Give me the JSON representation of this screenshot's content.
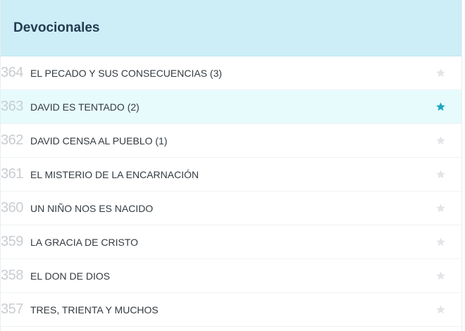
{
  "header": {
    "title": "Devocionales"
  },
  "colors": {
    "header_bg": "#cdeef6",
    "highlight_bg": "#e7fbfd",
    "star_active": "#1aa7c4",
    "star_inactive": "#e2e5e8"
  },
  "items": [
    {
      "number": "364",
      "title": "EL PECADO Y SUS CONSECUENCIAS (3)",
      "favorite": false,
      "highlighted": false
    },
    {
      "number": "363",
      "title": "DAVID ES TENTADO (2)",
      "favorite": true,
      "highlighted": true
    },
    {
      "number": "362",
      "title": "DAVID CENSA AL PUEBLO (1)",
      "favorite": false,
      "highlighted": false
    },
    {
      "number": "361",
      "title": "EL MISTERIO DE LA ENCARNACIÓN",
      "favorite": false,
      "highlighted": false
    },
    {
      "number": "360",
      "title": "UN NIÑO NOS ES NACIDO",
      "favorite": false,
      "highlighted": false
    },
    {
      "number": "359",
      "title": "LA GRACIA DE CRISTO",
      "favorite": false,
      "highlighted": false
    },
    {
      "number": "358",
      "title": "EL DON DE DIOS",
      "favorite": false,
      "highlighted": false
    },
    {
      "number": "357",
      "title": "TRES, TRIENTA Y MUCHOS",
      "favorite": false,
      "highlighted": false
    }
  ]
}
